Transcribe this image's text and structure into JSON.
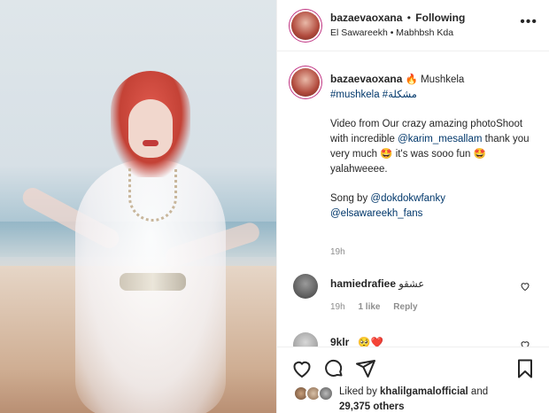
{
  "post": {
    "username": "bazaevaoxana",
    "dot": "•",
    "follow_status": "Following",
    "location": "El Sawareekh  •  Mabhbsh Kda",
    "more_label": "•••"
  },
  "caption": {
    "username": "bazaevaoxana",
    "title": "🔥 Mushkela",
    "hashtags": "#mushkela #مشكلة",
    "line1": "Video from Our crazy amazing photoShoot with incredible",
    "mention1": "@karim_mesallam",
    "line2": " thank you very much 🤩 it's was sooo fun 🤩 yalahweeee.",
    "song_prefix": "Song by ",
    "mention2": "@dokdokwfanky",
    "mention3": "@elsawareekh_fans",
    "time": "19h"
  },
  "comments": [
    {
      "username": "hamiedrafiee",
      "text": "عشقو",
      "time": "19h",
      "likes": "1 like",
      "reply": "Reply"
    },
    {
      "username": "9klr_",
      "text": "🥺❤️"
    }
  ],
  "likes": {
    "prefix": "Liked by ",
    "user": "khalilgamalofficial",
    "mid": " and",
    "count": "29,375 others"
  },
  "icons": [
    "heart-icon",
    "comment-icon",
    "share-icon",
    "bookmark-icon",
    "more-icon"
  ]
}
